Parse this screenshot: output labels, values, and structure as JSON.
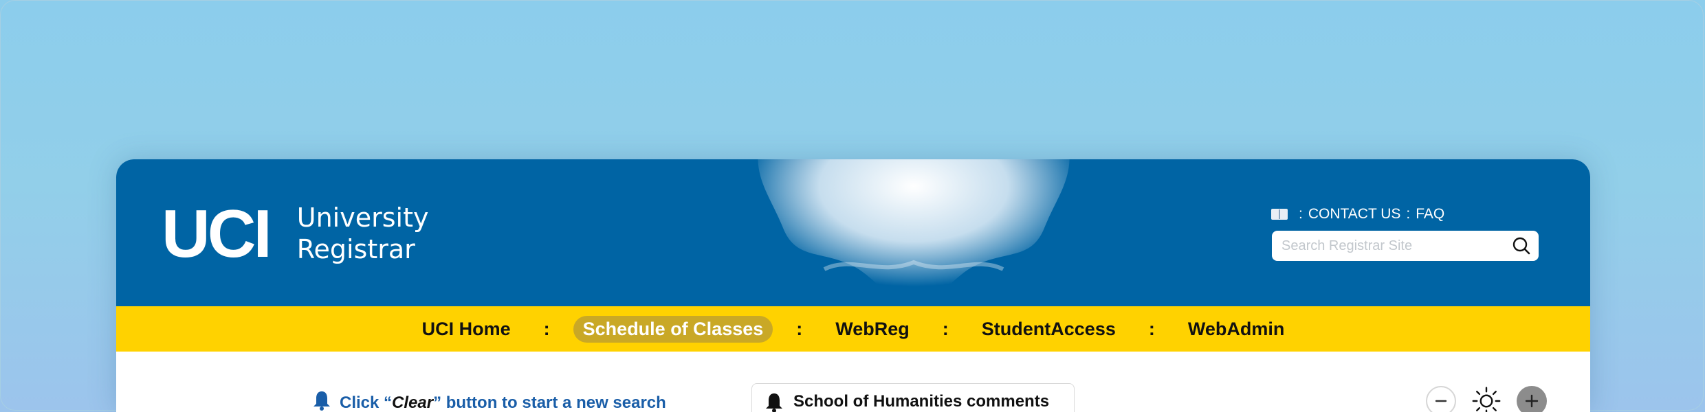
{
  "header": {
    "logo_mark": "UCI",
    "logo_line1": "University",
    "logo_line2": "Registrar",
    "util_sep": ":",
    "contact_label": "CONTACT US",
    "faq_label": "FAQ",
    "search_placeholder": "Search Registrar Site"
  },
  "nav": {
    "separator": ":",
    "items": [
      {
        "label": "UCI Home",
        "active": false
      },
      {
        "label": "Schedule of Classes",
        "active": true
      },
      {
        "label": "WebReg",
        "active": false
      },
      {
        "label": "StudentAccess",
        "active": false
      },
      {
        "label": "WebAdmin",
        "active": false
      }
    ]
  },
  "content": {
    "tip_prefix": "Click “",
    "tip_emphasis": "Clear",
    "tip_suffix": "” button to start a new search",
    "comment_title": "School of Humanities comments"
  },
  "colors": {
    "header_blue": "#0064a4",
    "nav_gold": "#ffd200",
    "active_gold": "#c9a826",
    "link_blue": "#1a5ea8"
  },
  "icons": {
    "contact": "book-icon",
    "search": "search-icon",
    "tip": "bell-icon",
    "comment": "bell-icon",
    "zoom_out": "minus-icon",
    "theme": "sun-icon",
    "zoom_in": "plus-icon"
  }
}
